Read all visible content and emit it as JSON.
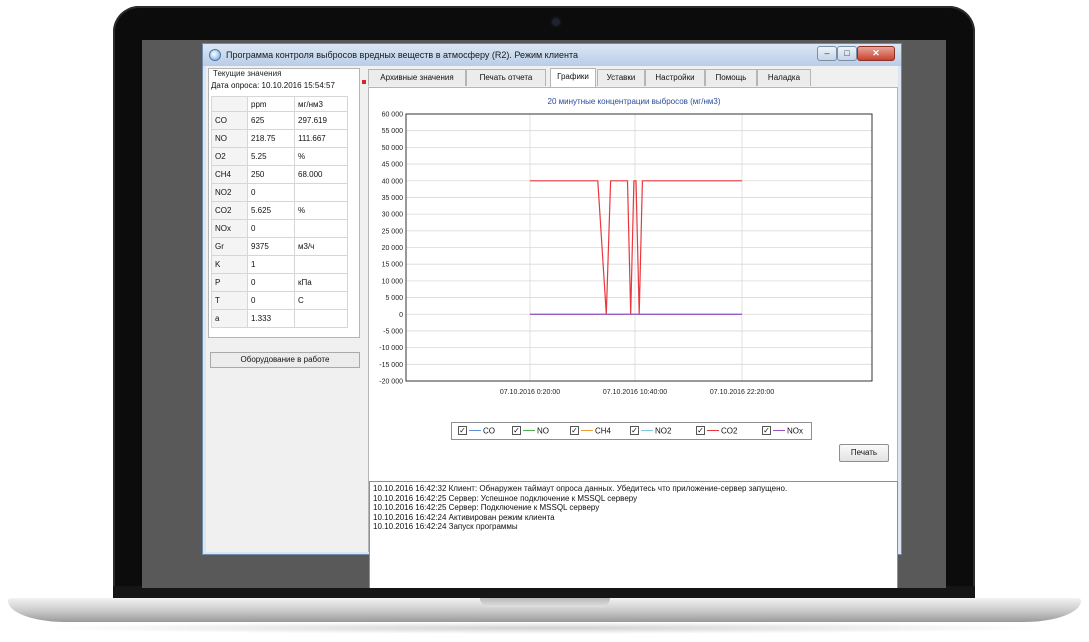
{
  "window": {
    "title": "Программа контроля выбросов вредных веществ в атмосферу (R2). Режим клиента",
    "controls": {
      "minimize": "–",
      "maximize": "□",
      "close": "✕"
    }
  },
  "left_panel": {
    "group_title": "Текущие значения",
    "poll_date": "Дата опроса: 10.10.2016 15:54:57",
    "columns": [
      "",
      "ppm",
      "мг/нм3"
    ],
    "rows": [
      [
        "CO",
        "625",
        "297.619"
      ],
      [
        "NO",
        "218.75",
        "111.667"
      ],
      [
        "O2",
        "5.25",
        "%"
      ],
      [
        "CH4",
        "250",
        "68.000"
      ],
      [
        "NO2",
        "0",
        ""
      ],
      [
        "CO2",
        "5.625",
        "%"
      ],
      [
        "NOx",
        "0",
        ""
      ],
      [
        "Gr",
        "9375",
        "м3/ч"
      ],
      [
        "K",
        "1",
        ""
      ],
      [
        "P",
        "0",
        "кПа"
      ],
      [
        "T",
        "0",
        "C"
      ],
      [
        "a",
        "1.333",
        ""
      ]
    ],
    "status_button": "Оборудование в работе"
  },
  "tabs": [
    {
      "label": "Архивные значения",
      "active": false
    },
    {
      "label": "Печать отчета",
      "active": false
    },
    {
      "label": "Графики",
      "active": true
    },
    {
      "label": "Уставки",
      "active": false
    },
    {
      "label": "Настройки",
      "active": false
    },
    {
      "label": "Помощь",
      "active": false
    },
    {
      "label": "Наладка",
      "active": false
    }
  ],
  "print_button": "Печать",
  "chart_data": {
    "type": "line",
    "title": "20 минутные концентрации выбросов (мг/нм3)",
    "xlabel": "",
    "ylabel": "",
    "ylim": [
      -20000,
      60000
    ],
    "y_ticks": [
      "60 000",
      "55 000",
      "50 000",
      "45 000",
      "40 000",
      "35 000",
      "30 000",
      "25 000",
      "20 000",
      "15 000",
      "10 000",
      "5 000",
      "0",
      "-5 000",
      "-10 000",
      "-15 000",
      "-20 000"
    ],
    "x_tick_labels": [
      "07.10.2016 0:20:00",
      "07.10.2016 10:40:00",
      "07.10.2016 22:20:00"
    ],
    "x_range": [
      0,
      100
    ],
    "grid": true,
    "legend_position": "bottom",
    "series": [
      {
        "name": "CO",
        "color": "#5b8fd6",
        "x": [
          0,
          100
        ],
        "values": [
          0,
          0
        ]
      },
      {
        "name": "NO",
        "color": "#4caf50",
        "x": [
          0,
          100
        ],
        "values": [
          0,
          0
        ]
      },
      {
        "name": "CH4",
        "color": "#f0a030",
        "x": [
          0,
          100
        ],
        "values": [
          0,
          0
        ]
      },
      {
        "name": "NO2",
        "color": "#7ec8e3",
        "x": [
          0,
          100
        ],
        "values": [
          0,
          0
        ]
      },
      {
        "name": "CO2",
        "color": "#e8383d",
        "x": [
          0,
          32,
          36,
          38,
          46,
          47.5,
          49,
          50,
          51.5,
          53,
          54,
          100
        ],
        "values": [
          40000,
          40000,
          0,
          40000,
          40000,
          0,
          40000,
          40000,
          0,
          40000,
          40000,
          40000
        ]
      },
      {
        "name": "NOx",
        "color": "#9c4fc4",
        "x": [
          0,
          100
        ],
        "values": [
          0,
          0
        ]
      }
    ]
  },
  "log": [
    "10.10.2016 16:42:32 Клиент: Обнаружен таймаут опроса данных. Убедитесь что приложение-сервер запущено.",
    "10.10.2016 16:42:25 Сервер: Успешное подключение к MSSQL серверу",
    "10.10.2016 16:42:25 Сервер: Подключение к MSSQL серверу",
    "10.10.2016 16:42:24 Активирован режим клиента",
    "10.10.2016 16:42:24 Запуск программы"
  ]
}
